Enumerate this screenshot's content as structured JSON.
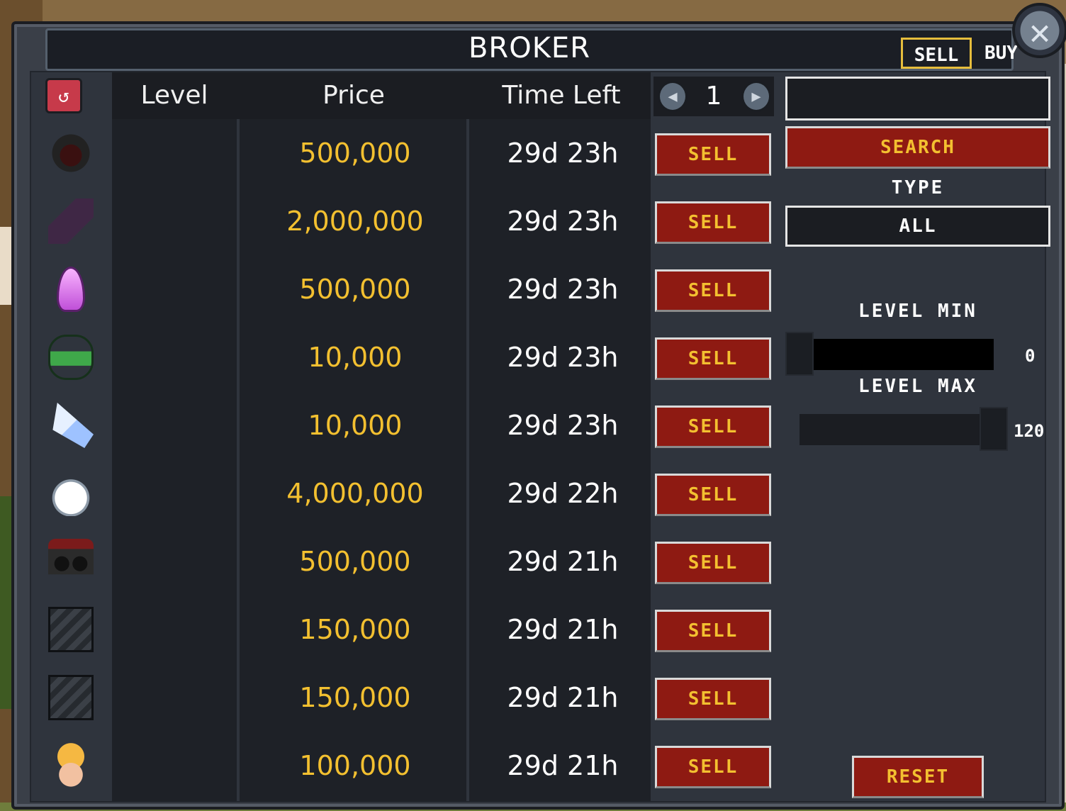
{
  "window": {
    "title": "BROKER",
    "mode_sell": "SELL",
    "mode_buy": "BUY",
    "close_icon": "close-icon"
  },
  "table": {
    "headers": {
      "level": "Level",
      "price": "Price",
      "time_left": "Time Left"
    },
    "page": "1",
    "rows": [
      {
        "icon": "helmet-icon",
        "level": "",
        "price": "500,000",
        "time": "29d 23h",
        "action": "SELL"
      },
      {
        "icon": "raven-icon",
        "level": "",
        "price": "2,000,000",
        "time": "29d 23h",
        "action": "SELL"
      },
      {
        "icon": "crystal-icon",
        "level": "",
        "price": "500,000",
        "time": "29d 23h",
        "action": "SELL"
      },
      {
        "icon": "snake-icon",
        "level": "",
        "price": "10,000",
        "time": "29d 23h",
        "action": "SELL"
      },
      {
        "icon": "wing-icon",
        "level": "",
        "price": "10,000",
        "time": "29d 23h",
        "action": "SELL"
      },
      {
        "icon": "beard-icon",
        "level": "",
        "price": "4,000,000",
        "time": "29d 22h",
        "action": "SELL"
      },
      {
        "icon": "goggles-icon",
        "level": "",
        "price": "500,000",
        "time": "29d 21h",
        "action": "SELL"
      },
      {
        "icon": "empty-slot-icon",
        "level": "",
        "price": "150,000",
        "time": "29d 21h",
        "action": "SELL"
      },
      {
        "icon": "empty-slot-icon",
        "level": "",
        "price": "150,000",
        "time": "29d 21h",
        "action": "SELL"
      },
      {
        "icon": "egg-hat-icon",
        "level": "",
        "price": "100,000",
        "time": "29d 21h",
        "action": "SELL"
      }
    ]
  },
  "filters": {
    "search_value": "",
    "search_button": "SEARCH",
    "type_label": "TYPE",
    "type_value": "ALL",
    "level_min_label": "LEVEL MIN",
    "level_min_value": "0",
    "level_max_label": "LEVEL MAX",
    "level_max_value": "120",
    "reset_button": "RESET"
  },
  "colors": {
    "price": "#f3c030",
    "button_red": "#8e1a12",
    "accent_gold": "#e6bd3c"
  }
}
